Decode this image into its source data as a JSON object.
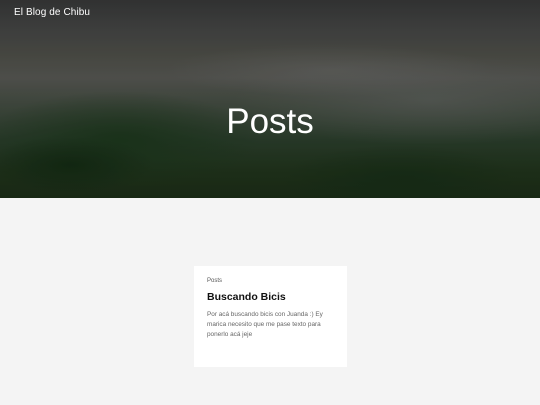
{
  "header": {
    "site_title": "El Blog de Chibu",
    "page_heading": "Posts"
  },
  "posts": [
    {
      "category": "Posts",
      "title": "Buscando Bicis",
      "excerpt": "Por acá buscando bicis con Juanda :) Ey marica necesito que me pase texto para ponerlo acá jeje"
    }
  ]
}
